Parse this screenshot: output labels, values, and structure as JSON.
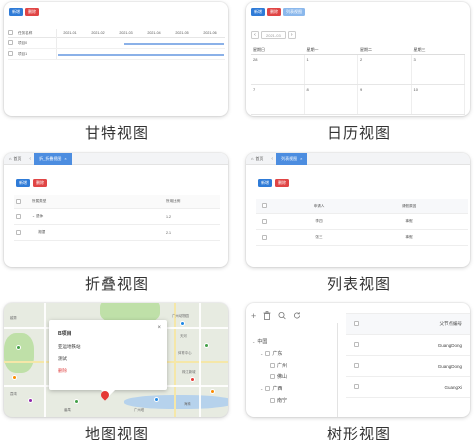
{
  "colors": {
    "primary": "#2f7bd7",
    "danger": "#e04545",
    "tab_active": "#4c8de0",
    "gantt_bar": "#8bb1e8",
    "map_pin": "#e53935"
  },
  "gantt": {
    "caption": "甘特视图",
    "toolbar": {
      "add": "新增",
      "delete": "删除"
    },
    "header": {
      "name": "任务名称",
      "months": [
        "2021-01",
        "2021-02",
        "2021-03",
        "2021-04",
        "2021-05",
        "2021-06"
      ]
    },
    "rows": [
      {
        "name": "项目0"
      },
      {
        "name": "项目1"
      }
    ]
  },
  "calendar": {
    "caption": "日历视图",
    "toolbar": {
      "add": "新增",
      "delete": "删除",
      "list": "列表视图"
    },
    "nav": {
      "prev": "‹",
      "date": "2021-03",
      "next": "›"
    },
    "weekdays": [
      "星期日",
      "星期一",
      "星期二",
      "星期三"
    ],
    "weeks": [
      [
        "28",
        "1",
        "2",
        "3"
      ],
      [
        "7",
        "8",
        "9",
        "10"
      ]
    ]
  },
  "fold": {
    "caption": "折叠视图",
    "tabs": {
      "home": "首页",
      "active": "折_折叠视图"
    },
    "toolbar": {
      "add": "新增",
      "delete": "删除"
    },
    "header": {
      "type": "所属类型",
      "ratio": "所用比例"
    },
    "rows": [
      {
        "type": "退休",
        "ratio": "1.2",
        "expand": "⌄"
      },
      {
        "type": "湘潭",
        "ratio": "2.1"
      }
    ]
  },
  "list": {
    "caption": "列表视图",
    "tabs": {
      "home": "首页",
      "active": "列表视图"
    },
    "toolbar": {
      "add": "新增",
      "delete": "删除"
    },
    "header": {
      "applicant": "申请人",
      "reason": "请假原因"
    },
    "rows": [
      {
        "applicant": "李四",
        "reason": "事假"
      },
      {
        "applicant": "张三",
        "reason": "事假"
      }
    ]
  },
  "map": {
    "caption": "地图视图",
    "popup": {
      "title": "B项目",
      "line1": "亚运地铁站",
      "line2": "测试",
      "line3": "删除",
      "close": "×"
    },
    "labels": [
      "广州动物园",
      "天河",
      "体育中心",
      "珠江新城",
      "海珠",
      "广州塔",
      "越秀",
      "荔湾",
      "番禺"
    ]
  },
  "tree": {
    "caption": "树形视图",
    "nodes": [
      {
        "label": "中国",
        "chev": "⌄"
      },
      {
        "label": "广东",
        "chev": "⌄"
      },
      {
        "label": "广州"
      },
      {
        "label": "佛山"
      },
      {
        "label": "广西",
        "chev": "⌄"
      },
      {
        "label": "南宁"
      }
    ],
    "table": {
      "header": "父节点编号",
      "rows": [
        "GuangDong",
        "GuangDong",
        "GuangXi"
      ]
    }
  }
}
